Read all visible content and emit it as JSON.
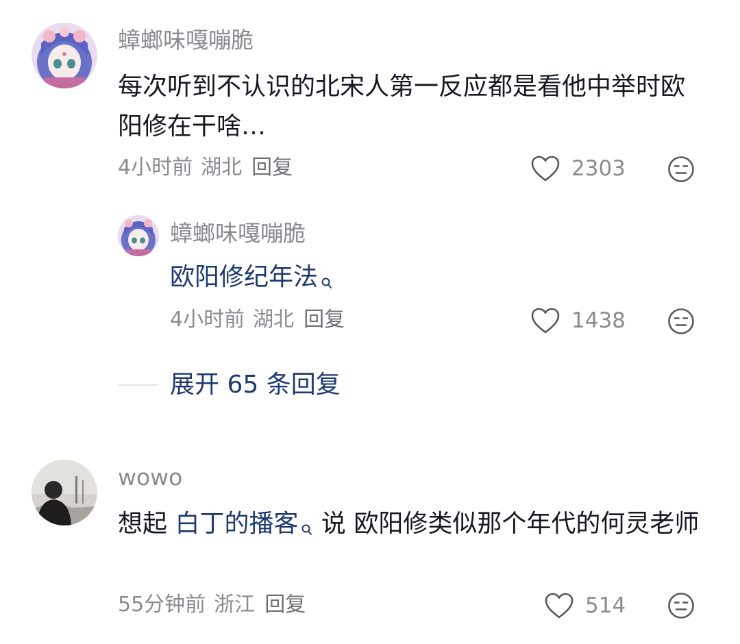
{
  "comments": [
    {
      "username": "蟑螂味嘎嘣脆",
      "text": "每次听到不认识的北宋人第一反应都是看他中举时欧阳修在干啥…",
      "time": "4小时前",
      "location": "湖北",
      "reply_label": "回复",
      "likes": "2303",
      "replies": [
        {
          "username": "蟑螂味嘎嘣脆",
          "link_text": "欧阳修纪年法",
          "time": "4小时前",
          "location": "湖北",
          "reply_label": "回复",
          "likes": "1438"
        }
      ],
      "expand_label": "展开 65 条回复"
    },
    {
      "username": "wowo",
      "text_before": "想起 ",
      "link_text": "白丁的播客",
      "text_after": " 说 欧阳修类似那个年代的何灵老师",
      "time": "55分钟前",
      "location": "浙江",
      "reply_label": "回复",
      "likes": "514"
    }
  ],
  "icons": {
    "like": "heart-outline-icon",
    "dislike": "neutral-face-icon",
    "search": "search-icon"
  },
  "colors": {
    "link": "#1e3a6e",
    "meta": "#8a8b91",
    "text": "#161823"
  }
}
